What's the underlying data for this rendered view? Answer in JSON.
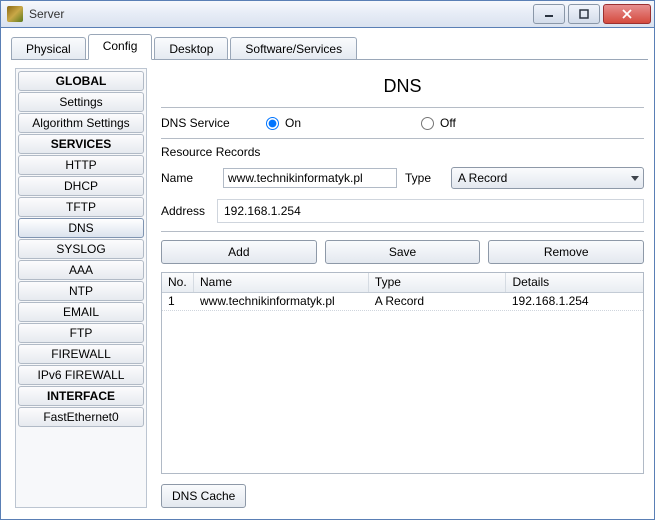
{
  "window": {
    "title": "Server"
  },
  "tabs": {
    "physical": "Physical",
    "config": "Config",
    "desktop": "Desktop",
    "software": "Software/Services"
  },
  "sidebar": {
    "global_header": "GLOBAL",
    "settings": "Settings",
    "algorithm": "Algorithm Settings",
    "services_header": "SERVICES",
    "http": "HTTP",
    "dhcp": "DHCP",
    "tftp": "TFTP",
    "dns": "DNS",
    "syslog": "SYSLOG",
    "aaa": "AAA",
    "ntp": "NTP",
    "email": "EMAIL",
    "ftp": "FTP",
    "firewall": "FIREWALL",
    "ipv6fw": "IPv6 FIREWALL",
    "interface_header": "INTERFACE",
    "fe0": "FastEthernet0"
  },
  "dns": {
    "title": "DNS",
    "service_label": "DNS Service",
    "on_label": "On",
    "off_label": "Off",
    "service_state": "on",
    "records_label": "Resource Records",
    "name_label": "Name",
    "name_value": "www.technikinformatyk.pl",
    "type_label": "Type",
    "type_value": "A Record",
    "address_label": "Address",
    "address_value": "192.168.1.254",
    "add_btn": "Add",
    "save_btn": "Save",
    "remove_btn": "Remove",
    "cache_btn": "DNS Cache",
    "columns": {
      "no": "No.",
      "name": "Name",
      "type": "Type",
      "details": "Details"
    },
    "rows": [
      {
        "no": "1",
        "name": "www.technikinformatyk.pl",
        "type": "A Record",
        "details": "192.168.1.254"
      }
    ]
  }
}
